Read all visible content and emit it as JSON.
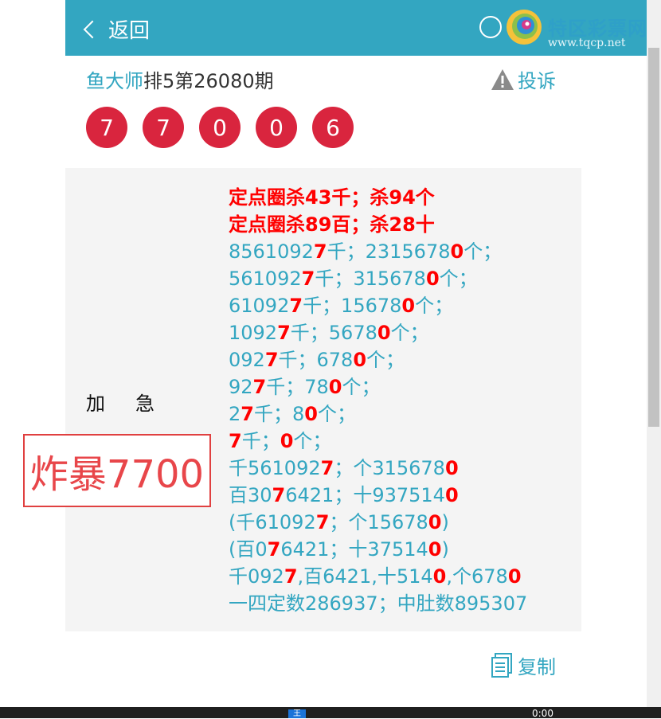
{
  "header": {
    "back_label": "返回",
    "logo_text": "特区彩票网",
    "logo_url": "www.tqcp.net"
  },
  "title": {
    "author": "鱼大师",
    "rest": "排5第26080期"
  },
  "complain_label": "投诉",
  "balls": [
    "7",
    "7",
    "0",
    "0",
    "6"
  ],
  "content": {
    "label": "加急",
    "lines": [
      [
        {
          "t": "定点圈杀43千；杀94个",
          "r": true
        }
      ],
      [
        {
          "t": "定点圈杀89百；杀28十",
          "r": true
        }
      ],
      [
        {
          "t": "856109"
        },
        {
          "t": "27",
          "r": false
        },
        {
          "t": "",
          "r": false
        }
      ],
      [],
      [],
      [],
      [],
      [],
      [],
      [],
      [],
      [],
      [],
      [],
      [],
      []
    ]
  },
  "lines": [
    [
      {
        "t": "定点圈杀43千；杀94个",
        "r": true
      }
    ],
    [
      {
        "t": "定点圈杀89百；杀28十",
        "r": true
      }
    ],
    [
      {
        "t": "8561092"
      },
      {
        "t": "7",
        "r": true
      },
      {
        "t": "千；231567 8"
      }
    ],
    [],
    [],
    [],
    [],
    [],
    [],
    [],
    [],
    [],
    [],
    [],
    [],
    []
  ],
  "rich_lines": [
    [
      [
        "定点圈杀43千；杀94个",
        1
      ]
    ],
    [
      [
        "定点圈杀89百；杀28十",
        1
      ]
    ],
    [
      [
        "856109 2",
        0
      ],
      [
        "7",
        1
      ],
      [
        "千；231567 8",
        0
      ],
      [
        "0",
        1
      ],
      [
        "个；",
        0
      ]
    ],
    [
      [
        "56109 2",
        0
      ],
      [
        "7",
        1
      ],
      [
        "千；31567 8",
        0
      ],
      [
        "0",
        1
      ],
      [
        "个；",
        0
      ]
    ],
    [
      [
        "6109 2",
        0
      ],
      [
        "7",
        1
      ],
      [
        "千；1567 8",
        0
      ],
      [
        "0",
        1
      ],
      [
        "个；",
        0
      ]
    ],
    [
      [
        "109 2",
        0
      ],
      [
        "7",
        1
      ],
      [
        "千；567 8",
        0
      ],
      [
        "0",
        1
      ],
      [
        "个；",
        0
      ]
    ],
    [
      [
        "09 2",
        0
      ],
      [
        "7",
        1
      ],
      [
        "千；67 8",
        0
      ],
      [
        "0",
        1
      ],
      [
        "个；",
        0
      ]
    ],
    [
      [
        "9 2",
        0
      ],
      [
        "7",
        1
      ],
      [
        "千；7 8",
        0
      ],
      [
        "0",
        1
      ],
      [
        "个；",
        0
      ]
    ],
    [
      [
        "2",
        0
      ],
      [
        "7",
        1
      ],
      [
        "千；8",
        0
      ],
      [
        "0",
        1
      ],
      [
        "个；",
        0
      ]
    ],
    [
      [
        "7",
        1
      ],
      [
        "千；",
        0
      ],
      [
        "0",
        1
      ],
      [
        "个；",
        0
      ]
    ],
    [
      [
        "千56109 2",
        0
      ],
      [
        "7",
        1
      ],
      [
        "；个31567 8",
        0
      ],
      [
        "0",
        1
      ]
    ],
    [
      [
        "百30",
        0
      ],
      [
        "7",
        1
      ],
      [
        "6421；十937514",
        0
      ],
      [
        "0",
        1
      ]
    ],
    [
      [
        "(千6109 2",
        0
      ],
      [
        "7",
        1
      ],
      [
        "；个1567 8",
        0
      ],
      [
        "0",
        1
      ],
      [
        ")",
        0
      ]
    ],
    [
      [
        "(百0",
        0
      ],
      [
        "7",
        1
      ],
      [
        "6421；十37514",
        0
      ],
      [
        "0",
        1
      ],
      [
        ")",
        0
      ]
    ],
    [
      [
        "千09 2",
        0
      ],
      [
        "7",
        1
      ],
      [
        ",百6421,十514",
        0
      ],
      [
        "0",
        1
      ],
      [
        ",个67 8",
        0
      ],
      [
        "0",
        1
      ]
    ],
    [
      [
        "一四定数286937；中肚数895307",
        0
      ]
    ]
  ],
  "copy_label": "复制",
  "stamp_text": "炸暴7700",
  "taskbar": {
    "ime_label": "王",
    "clock": "0:00"
  },
  "colors": {
    "accent": "#33a6c1",
    "ball": "#d9253e",
    "highlight": "#ff0000",
    "stamp": "#e8464a"
  }
}
